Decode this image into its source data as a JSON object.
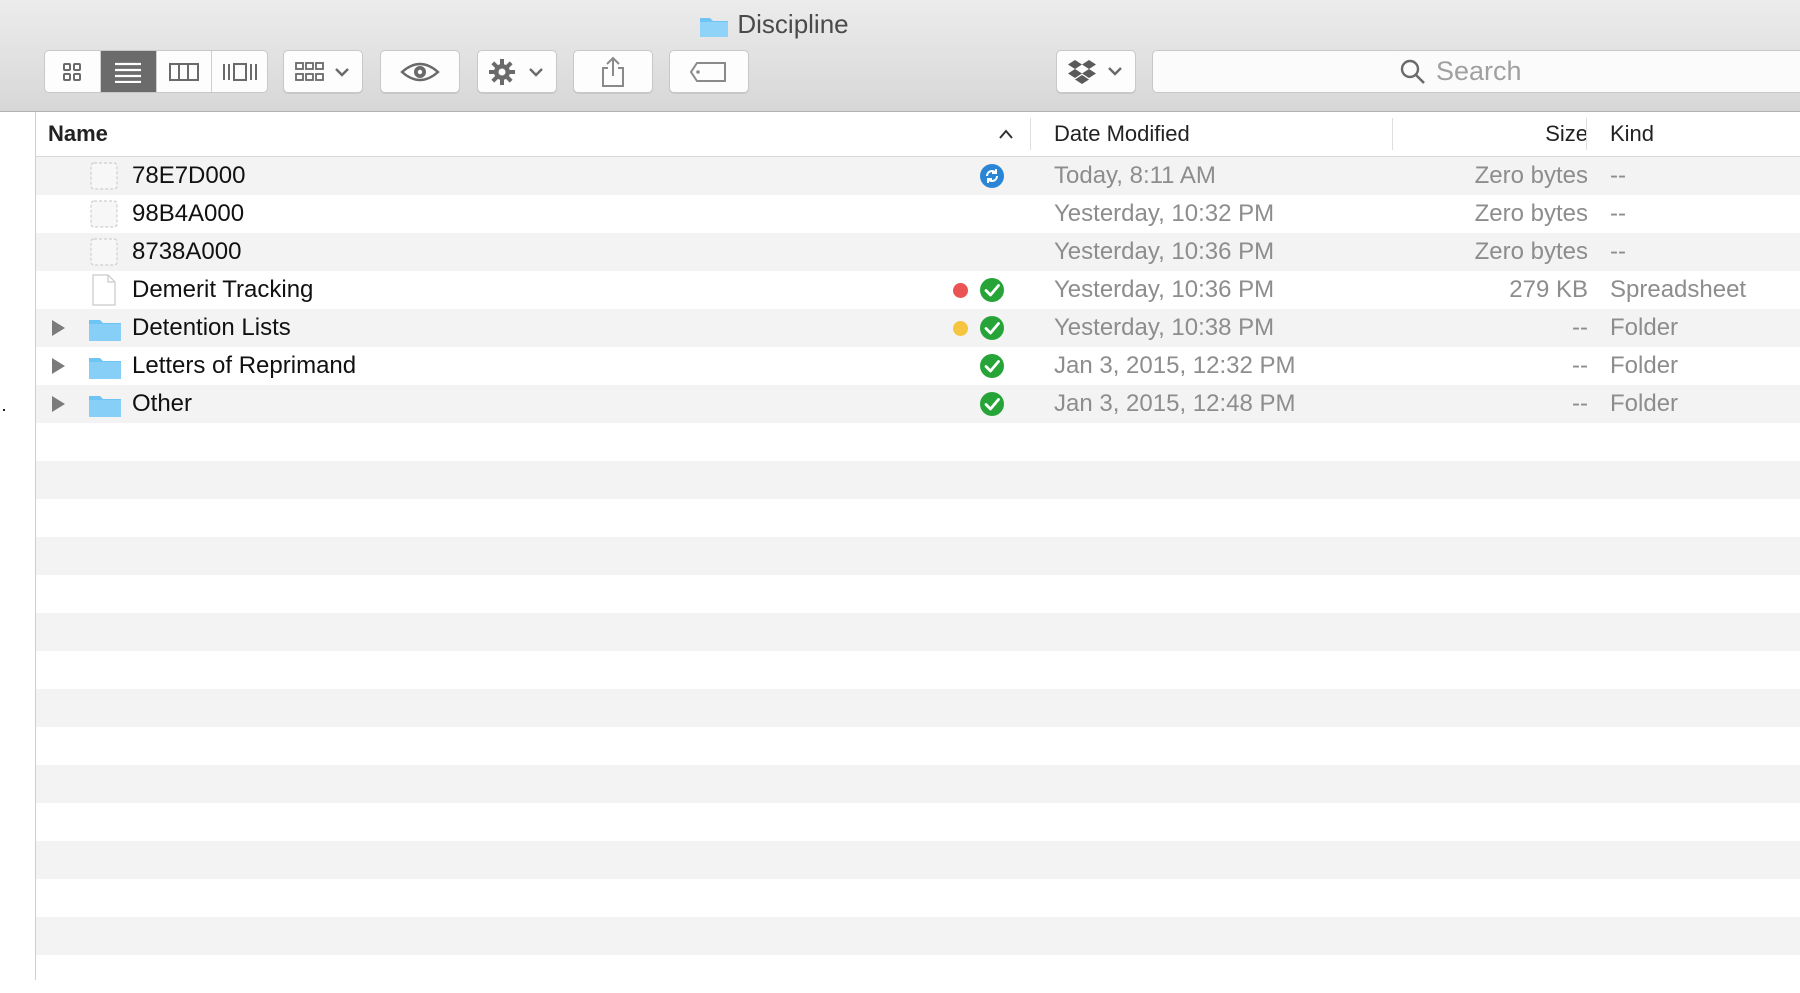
{
  "window": {
    "title": "Discipline"
  },
  "toolbar": {
    "view_buttons": [
      {
        "icon": "icon-view-icon",
        "active": false
      },
      {
        "icon": "list-view-icon",
        "active": true
      },
      {
        "icon": "column-view-icon",
        "active": false
      },
      {
        "icon": "cover-flow-view-icon",
        "active": false
      }
    ],
    "arrange_icon": "arrange-icon",
    "quicklook_icon": "eye-icon",
    "action_icon": "gear-icon",
    "share_icon": "share-icon",
    "tag_icon": "tag-icon",
    "dropbox_icon": "dropbox-icon",
    "search_placeholder": "Search"
  },
  "columns": {
    "name": "Name",
    "date": "Date Modified",
    "size": "Size",
    "kind": "Kind"
  },
  "files": [
    {
      "name": "78E7D000",
      "date": "Today, 8:11 AM",
      "size": "Zero bytes",
      "kind": "--",
      "type": "placeholder",
      "status": "syncing",
      "tag": null
    },
    {
      "name": "98B4A000",
      "date": "Yesterday, 10:32 PM",
      "size": "Zero bytes",
      "kind": "--",
      "type": "placeholder",
      "status": null,
      "tag": null
    },
    {
      "name": "8738A000",
      "date": "Yesterday, 10:36 PM",
      "size": "Zero bytes",
      "kind": "--",
      "type": "placeholder",
      "status": null,
      "tag": null
    },
    {
      "name": "Demerit Tracking",
      "date": "Yesterday, 10:36 PM",
      "size": "279 KB",
      "kind": "Spreadsheet",
      "type": "document",
      "status": "synced",
      "tag": "#ec5353"
    },
    {
      "name": "Detention Lists",
      "date": "Yesterday, 10:38 PM",
      "size": "--",
      "kind": "Folder",
      "type": "folder",
      "status": "synced",
      "tag": "#f6c540"
    },
    {
      "name": "Letters of Reprimand",
      "date": "Jan 3, 2015, 12:32 PM",
      "size": "--",
      "kind": "Folder",
      "type": "folder",
      "status": "synced",
      "tag": null
    },
    {
      "name": "Other",
      "date": "Jan 3, 2015, 12:48 PM",
      "size": "--",
      "kind": "Folder",
      "type": "folder",
      "status": "synced",
      "tag": null
    }
  ],
  "colors": {
    "folder": "#6ec4f4",
    "synced": "#27a437",
    "syncing": "#2a86d4",
    "selected_view": "#6b6b6b"
  }
}
